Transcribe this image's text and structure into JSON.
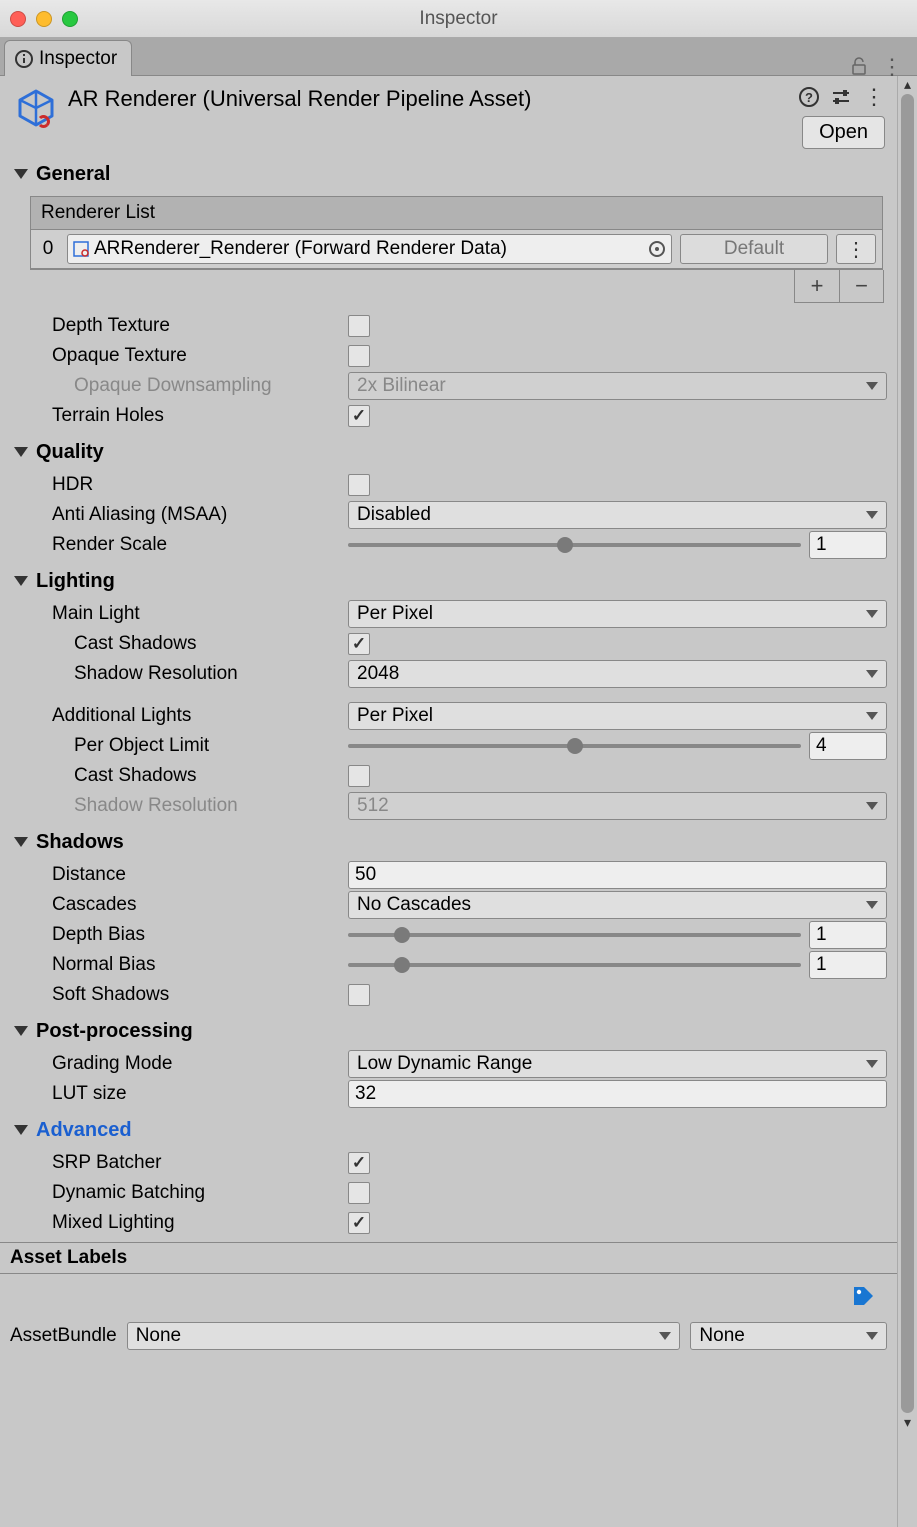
{
  "window": {
    "title": "Inspector"
  },
  "tab": {
    "label": "Inspector"
  },
  "asset": {
    "title": "AR Renderer (Universal Render Pipeline Asset)",
    "open_btn": "Open"
  },
  "sections": {
    "general": {
      "title": "General",
      "renderer_list_header": "Renderer List",
      "renderer_index": "0",
      "renderer_name": "ARRenderer_Renderer (Forward Renderer Data)",
      "default_label": "Default",
      "depth_texture": "Depth Texture",
      "opaque_texture": "Opaque Texture",
      "opaque_downsampling": "Opaque Downsampling",
      "opaque_downsampling_val": "2x Bilinear",
      "terrain_holes": "Terrain Holes"
    },
    "quality": {
      "title": "Quality",
      "hdr": "HDR",
      "aa": "Anti Aliasing (MSAA)",
      "aa_val": "Disabled",
      "render_scale": "Render Scale",
      "render_scale_val": "1"
    },
    "lighting": {
      "title": "Lighting",
      "main_light": "Main Light",
      "main_light_val": "Per Pixel",
      "cast_shadows": "Cast Shadows",
      "shadow_res": "Shadow Resolution",
      "shadow_res_val": "2048",
      "add_lights": "Additional Lights",
      "add_lights_val": "Per Pixel",
      "per_obj_limit": "Per Object Limit",
      "per_obj_limit_val": "4",
      "add_cast_shadows": "Cast Shadows",
      "add_shadow_res": "Shadow Resolution",
      "add_shadow_res_val": "512"
    },
    "shadows": {
      "title": "Shadows",
      "distance": "Distance",
      "distance_val": "50",
      "cascades": "Cascades",
      "cascades_val": "No Cascades",
      "depth_bias": "Depth Bias",
      "depth_bias_val": "1",
      "normal_bias": "Normal Bias",
      "normal_bias_val": "1",
      "soft_shadows": "Soft Shadows"
    },
    "post": {
      "title": "Post-processing",
      "grading": "Grading Mode",
      "grading_val": "Low Dynamic Range",
      "lut": "LUT size",
      "lut_val": "32"
    },
    "advanced": {
      "title": "Advanced",
      "srp": "SRP Batcher",
      "dyn": "Dynamic Batching",
      "mixed": "Mixed Lighting"
    }
  },
  "footer": {
    "asset_labels": "Asset Labels",
    "asset_bundle": "AssetBundle",
    "none": "None"
  }
}
